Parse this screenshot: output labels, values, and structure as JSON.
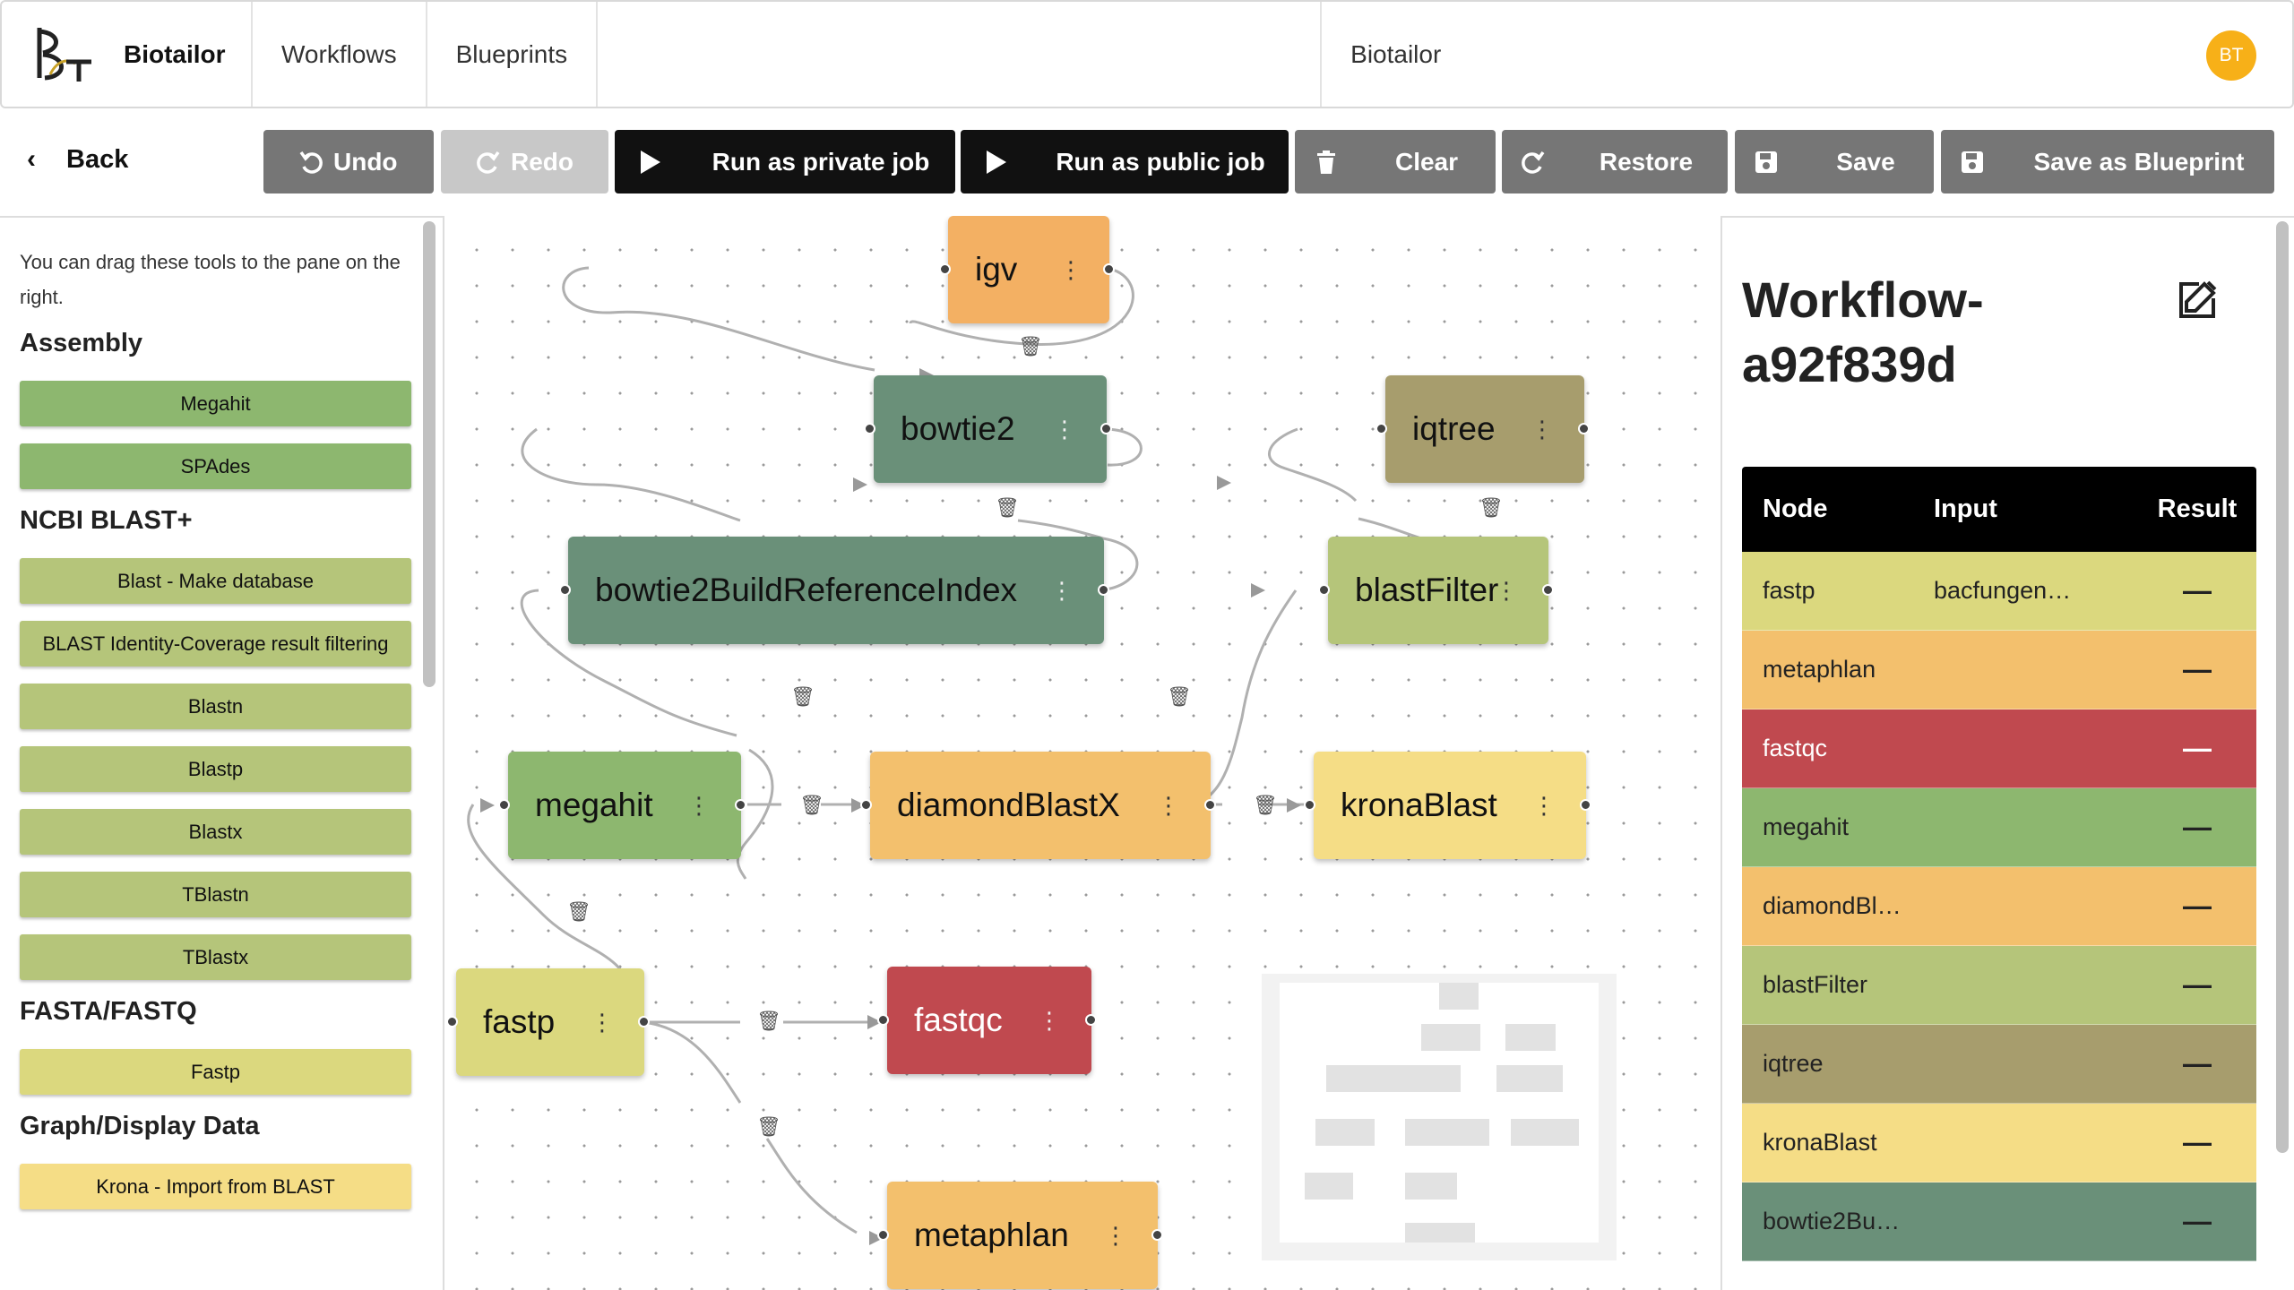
{
  "nav": {
    "brand": "Biotailor",
    "links": [
      "Workflows",
      "Blueprints"
    ],
    "title": "Biotailor",
    "avatar": "BT"
  },
  "toolbar": {
    "back": "Back",
    "undo": "Undo",
    "redo": "Redo",
    "run_private": "Run as private job",
    "run_public": "Run as public job",
    "clear": "Clear",
    "restore": "Restore",
    "save": "Save",
    "save_blueprint": "Save as Blueprint"
  },
  "sidebar": {
    "hint": "You can drag these tools to the pane on the right.",
    "categories": [
      {
        "name": "Assembly",
        "tools": [
          "Megahit",
          "SPAdes"
        ]
      },
      {
        "name": "NCBI BLAST+",
        "tools": [
          "Blast - Make database",
          "BLAST Identity-Coverage result filtering",
          "Blastn",
          "Blastp",
          "Blastx",
          "TBlastn",
          "TBlastx"
        ]
      },
      {
        "name": "FASTA/FASTQ",
        "tools": [
          "Fastp"
        ]
      },
      {
        "name": "Graph/Display Data",
        "tools": [
          "Krona - Import from BLAST"
        ]
      }
    ]
  },
  "canvas": {
    "nodes": [
      {
        "label": "igv",
        "color": "#f3b063"
      },
      {
        "label": "bowtie2",
        "color": "#6a9079"
      },
      {
        "label": "iqtree",
        "color": "#a79d6d"
      },
      {
        "label": "bowtie2BuildReferenceIndex",
        "color": "#6a9079"
      },
      {
        "label": "blastFilter",
        "color": "#b5c57a"
      },
      {
        "label": "megahit",
        "color": "#8db76f"
      },
      {
        "label": "diamondBlastX",
        "color": "#f3c06d"
      },
      {
        "label": "kronaBlast",
        "color": "#f5dd86"
      },
      {
        "label": "fastp",
        "color": "#dbd87e"
      },
      {
        "label": "fastqc",
        "color": "#c0494f"
      },
      {
        "label": "metaphlan",
        "color": "#f3c06d"
      }
    ]
  },
  "panel": {
    "title": "Workflow-a92f839d",
    "columns": [
      "Node",
      "Input",
      "Result"
    ],
    "rows": [
      {
        "node": "fastp",
        "input": "bacfungen…",
        "result": "—",
        "color": "#dbd87e",
        "text": "#222"
      },
      {
        "node": "metaphlan",
        "input": "",
        "result": "—",
        "color": "#f3c06d",
        "text": "#222"
      },
      {
        "node": "fastqc",
        "input": "",
        "result": "—",
        "color": "#c0494f",
        "text": "#fff"
      },
      {
        "node": "megahit",
        "input": "",
        "result": "—",
        "color": "#8db76f",
        "text": "#222"
      },
      {
        "node": "diamondBl…",
        "input": "",
        "result": "—",
        "color": "#f3c06d",
        "text": "#222"
      },
      {
        "node": "blastFilter",
        "input": "",
        "result": "—",
        "color": "#b5c57a",
        "text": "#222"
      },
      {
        "node": "iqtree",
        "input": "",
        "result": "—",
        "color": "#a79d6d",
        "text": "#222"
      },
      {
        "node": "kronaBlast",
        "input": "",
        "result": "—",
        "color": "#f5dd86",
        "text": "#222"
      },
      {
        "node": "bowtie2Bu…",
        "input": "",
        "result": "—",
        "color": "#6a9079",
        "text": "#222"
      }
    ]
  },
  "colors": {
    "tool_assembly": "#8db76f",
    "tool_blast": "#b5c57a",
    "tool_fasta": "#dbd87e",
    "tool_graph": "#f5dd86"
  }
}
